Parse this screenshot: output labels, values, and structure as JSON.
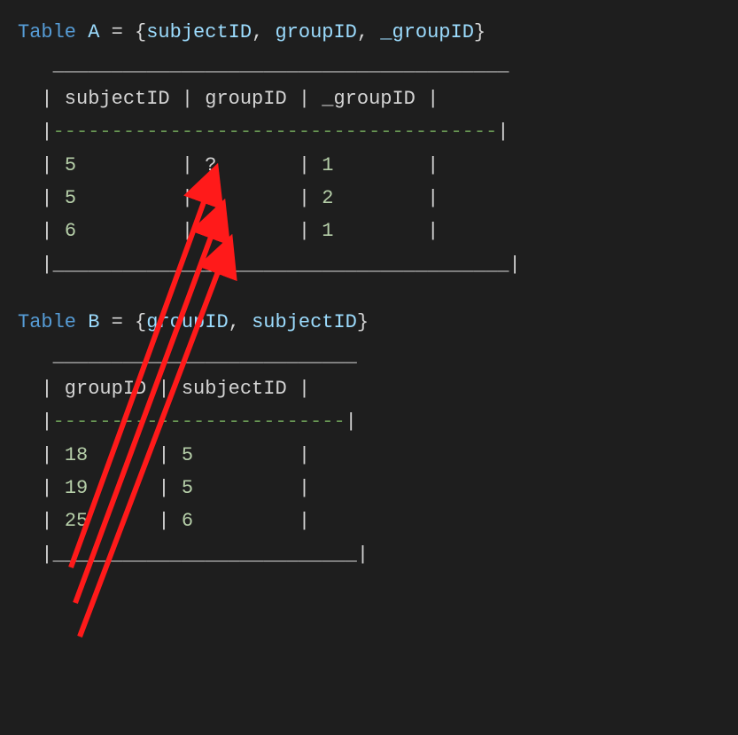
{
  "tableA": {
    "keyword": "Table",
    "name": "A",
    "equals": "=",
    "schema_open": "{",
    "schema_close": "}",
    "schema_sep": ", ",
    "cols": [
      "subjectID",
      "groupID",
      "_groupID"
    ],
    "top_border": " _______________________________________",
    "header_row": "| subjectID | groupID | _groupID |",
    "dash_row_pre": "|",
    "dash_row_mid": "--------------------------------------",
    "dash_row_post": "|",
    "rows": [
      {
        "c0": "5",
        "c1": "?",
        "c2": "1"
      },
      {
        "c0": "5",
        "c1": "?",
        "c2": "2"
      },
      {
        "c0": "6",
        "c1": "?",
        "c2": "1"
      }
    ],
    "row_tpl_pre0": "| ",
    "row_tpl_pad0": "         | ",
    "row_tpl_pad1": "       | ",
    "row_tpl_pad2": "        |",
    "bottom_border": "|_______________________________________|"
  },
  "tableB": {
    "keyword": "Table",
    "name": "B",
    "equals": "=",
    "schema_open": "{",
    "schema_close": "}",
    "schema_sep": ", ",
    "cols": [
      "groupID",
      "subjectID"
    ],
    "top_border": " __________________________",
    "header_row": "| groupID | subjectID |",
    "dash_row_pre": "|",
    "dash_row_mid": "-------------------------",
    "dash_row_post": "|",
    "rows": [
      {
        "c0": "18",
        "c1": "5"
      },
      {
        "c0": "19",
        "c1": "5"
      },
      {
        "c0": "25",
        "c1": "6"
      }
    ],
    "row_tpl_pre0": "| ",
    "row_tpl_pad0": "      | ",
    "row_tpl_pad1": "         |",
    "bottom_border": "|__________________________|"
  },
  "arrows": [
    {
      "from_row": 0,
      "to_row": 0
    },
    {
      "from_row": 1,
      "to_row": 1
    },
    {
      "from_row": 2,
      "to_row": 2
    }
  ]
}
